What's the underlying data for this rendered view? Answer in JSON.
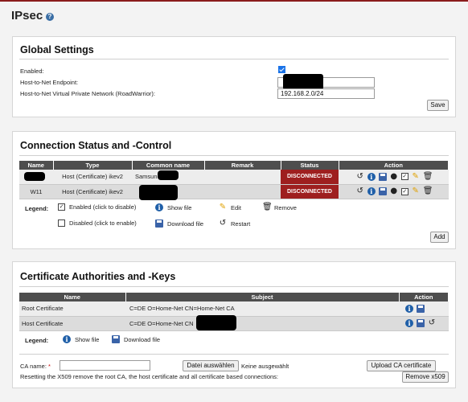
{
  "page": {
    "title": "IPsec",
    "help_glyph": "?"
  },
  "global_settings": {
    "title": "Global Settings",
    "enabled_label": "Enabled:",
    "enabled_checked": true,
    "endpoint_label": "Host-to-Net Endpoint:",
    "endpoint_value": "",
    "vpn_label": "Host-to-Net Virtual Private Network (RoadWarrior):",
    "vpn_value": "192.168.2.0/24",
    "save_label": "Save"
  },
  "connections": {
    "title": "Connection Status and -Control",
    "columns": [
      "Name",
      "Type",
      "Common name",
      "Remark",
      "Status",
      "Action"
    ],
    "rows": [
      {
        "name": "",
        "type": "Host (Certificate) ikev2",
        "common_name": "Samsun",
        "remark": "",
        "status": "DISCONNECTED"
      },
      {
        "name": "W11",
        "type": "Host (Certificate) ikev2",
        "common_name": "",
        "remark": "",
        "status": "DISCONNECTED"
      }
    ],
    "legend_label": "Legend:",
    "legend": {
      "enabled": "Enabled (click to disable)",
      "disabled": "Disabled (click to enable)",
      "show_file": "Show file",
      "download_file": "Download file",
      "edit": "Edit",
      "restart": "Restart",
      "remove": "Remove"
    },
    "add_label": "Add"
  },
  "certs": {
    "title": "Certificate Authorities and -Keys",
    "columns": [
      "Name",
      "Subject",
      "Action"
    ],
    "rows": [
      {
        "name": "Root Certificate",
        "subject": "C=DE O=Home-Net CN=Home-Net CA"
      },
      {
        "name": "Host Certificate",
        "subject": "C=DE O=Home-Net CN"
      }
    ],
    "legend_label": "Legend:",
    "legend": {
      "show_file": "Show file",
      "download_file": "Download file"
    },
    "ca_name_label": "CA name:",
    "required_mark": "*",
    "choose_file_label": "Datei auswählen",
    "no_file_label": "Keine ausgewählt",
    "upload_label": "Upload CA certificate",
    "reset_text": "Resetting the X509 remove the root CA, the host certificate and all certificate based connections:",
    "remove_x509_label": "Remove x509"
  },
  "colors": {
    "status_disconnected": "#9e1f1f",
    "header_bg": "#4e4e4e",
    "accent": "#1f5fa8"
  }
}
